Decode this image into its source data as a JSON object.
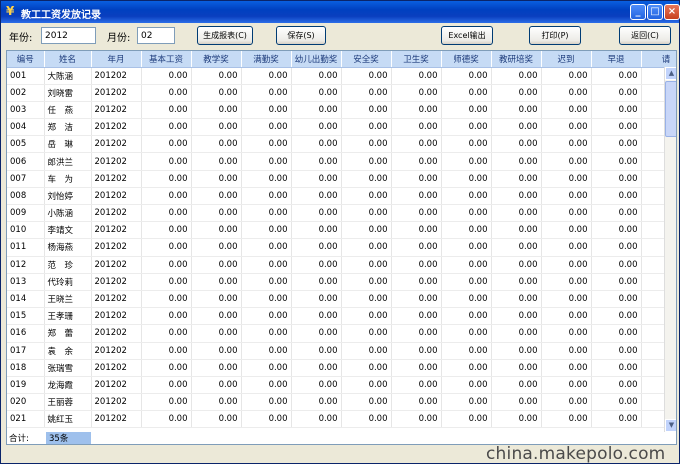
{
  "window": {
    "title": "教工工资发放记录"
  },
  "filters": {
    "year_label": "年份:",
    "year_value": "2012",
    "month_label": "月份:",
    "month_value": "02"
  },
  "toolbar": {
    "generate_label": "生成报表(C)",
    "save_label": "保存(S)",
    "excel_label": "Excel输出",
    "print_label": "打印(P)",
    "return_label": "返回(C)"
  },
  "table": {
    "headers": [
      "编号",
      "姓名",
      "年月",
      "基本工资",
      "教学奖",
      "满勤奖",
      "幼儿出勤奖",
      "安全奖",
      "卫生奖",
      "师德奖",
      "教研培奖",
      "迟到",
      "早退",
      "请"
    ],
    "rows": [
      {
        "id": "001",
        "name": "大陈涵",
        "ym": "201202",
        "v": [
          "0.00",
          "0.00",
          "0.00",
          "0.00",
          "0.00",
          "0.00",
          "0.00",
          "0.00",
          "0.00",
          "0.00"
        ]
      },
      {
        "id": "002",
        "name": "刘晓雷",
        "ym": "201202",
        "v": [
          "0.00",
          "0.00",
          "0.00",
          "0.00",
          "0.00",
          "0.00",
          "0.00",
          "0.00",
          "0.00",
          "0.00"
        ]
      },
      {
        "id": "003",
        "name": "任　燕",
        "ym": "201202",
        "v": [
          "0.00",
          "0.00",
          "0.00",
          "0.00",
          "0.00",
          "0.00",
          "0.00",
          "0.00",
          "0.00",
          "0.00"
        ]
      },
      {
        "id": "004",
        "name": "郑　洁",
        "ym": "201202",
        "v": [
          "0.00",
          "0.00",
          "0.00",
          "0.00",
          "0.00",
          "0.00",
          "0.00",
          "0.00",
          "0.00",
          "0.00"
        ]
      },
      {
        "id": "005",
        "name": "岳　琳",
        "ym": "201202",
        "v": [
          "0.00",
          "0.00",
          "0.00",
          "0.00",
          "0.00",
          "0.00",
          "0.00",
          "0.00",
          "0.00",
          "0.00"
        ]
      },
      {
        "id": "006",
        "name": "郎洪兰",
        "ym": "201202",
        "v": [
          "0.00",
          "0.00",
          "0.00",
          "0.00",
          "0.00",
          "0.00",
          "0.00",
          "0.00",
          "0.00",
          "0.00"
        ]
      },
      {
        "id": "007",
        "name": "车　为",
        "ym": "201202",
        "v": [
          "0.00",
          "0.00",
          "0.00",
          "0.00",
          "0.00",
          "0.00",
          "0.00",
          "0.00",
          "0.00",
          "0.00"
        ]
      },
      {
        "id": "008",
        "name": "刘怡婷",
        "ym": "201202",
        "v": [
          "0.00",
          "0.00",
          "0.00",
          "0.00",
          "0.00",
          "0.00",
          "0.00",
          "0.00",
          "0.00",
          "0.00"
        ]
      },
      {
        "id": "009",
        "name": "小陈涵",
        "ym": "201202",
        "v": [
          "0.00",
          "0.00",
          "0.00",
          "0.00",
          "0.00",
          "0.00",
          "0.00",
          "0.00",
          "0.00",
          "0.00"
        ]
      },
      {
        "id": "010",
        "name": "李靖文",
        "ym": "201202",
        "v": [
          "0.00",
          "0.00",
          "0.00",
          "0.00",
          "0.00",
          "0.00",
          "0.00",
          "0.00",
          "0.00",
          "0.00"
        ]
      },
      {
        "id": "011",
        "name": "杨海燕",
        "ym": "201202",
        "v": [
          "0.00",
          "0.00",
          "0.00",
          "0.00",
          "0.00",
          "0.00",
          "0.00",
          "0.00",
          "0.00",
          "0.00"
        ]
      },
      {
        "id": "012",
        "name": "范　珍",
        "ym": "201202",
        "v": [
          "0.00",
          "0.00",
          "0.00",
          "0.00",
          "0.00",
          "0.00",
          "0.00",
          "0.00",
          "0.00",
          "0.00"
        ]
      },
      {
        "id": "013",
        "name": "代玲莉",
        "ym": "201202",
        "v": [
          "0.00",
          "0.00",
          "0.00",
          "0.00",
          "0.00",
          "0.00",
          "0.00",
          "0.00",
          "0.00",
          "0.00"
        ]
      },
      {
        "id": "014",
        "name": "王晓兰",
        "ym": "201202",
        "v": [
          "0.00",
          "0.00",
          "0.00",
          "0.00",
          "0.00",
          "0.00",
          "0.00",
          "0.00",
          "0.00",
          "0.00"
        ]
      },
      {
        "id": "015",
        "name": "王孝珊",
        "ym": "201202",
        "v": [
          "0.00",
          "0.00",
          "0.00",
          "0.00",
          "0.00",
          "0.00",
          "0.00",
          "0.00",
          "0.00",
          "0.00"
        ]
      },
      {
        "id": "016",
        "name": "郑　蕾",
        "ym": "201202",
        "v": [
          "0.00",
          "0.00",
          "0.00",
          "0.00",
          "0.00",
          "0.00",
          "0.00",
          "0.00",
          "0.00",
          "0.00"
        ]
      },
      {
        "id": "017",
        "name": "袁　余",
        "ym": "201202",
        "v": [
          "0.00",
          "0.00",
          "0.00",
          "0.00",
          "0.00",
          "0.00",
          "0.00",
          "0.00",
          "0.00",
          "0.00"
        ]
      },
      {
        "id": "018",
        "name": "张瑞雪",
        "ym": "201202",
        "v": [
          "0.00",
          "0.00",
          "0.00",
          "0.00",
          "0.00",
          "0.00",
          "0.00",
          "0.00",
          "0.00",
          "0.00"
        ]
      },
      {
        "id": "019",
        "name": "龙海霞",
        "ym": "201202",
        "v": [
          "0.00",
          "0.00",
          "0.00",
          "0.00",
          "0.00",
          "0.00",
          "0.00",
          "0.00",
          "0.00",
          "0.00"
        ]
      },
      {
        "id": "020",
        "name": "王丽蓉",
        "ym": "201202",
        "v": [
          "0.00",
          "0.00",
          "0.00",
          "0.00",
          "0.00",
          "0.00",
          "0.00",
          "0.00",
          "0.00",
          "0.00"
        ]
      },
      {
        "id": "021",
        "name": "姚红玉",
        "ym": "201202",
        "v": [
          "0.00",
          "0.00",
          "0.00",
          "0.00",
          "0.00",
          "0.00",
          "0.00",
          "0.00",
          "0.00",
          "0.00"
        ]
      }
    ]
  },
  "footer": {
    "total_label": "合计:",
    "total_count": "35条"
  },
  "icons": {
    "app": "coin-icon",
    "minimize": "minimize-icon",
    "maximize": "maximize-icon",
    "close": "close-icon",
    "scroll_up": "scroll-up-icon",
    "scroll_down": "scroll-down-icon"
  },
  "watermark": "china.makepolo.com",
  "colors": {
    "title_bar": "#0040c0",
    "header_bg": "#c6dbf5",
    "footer_count_bg": "#9ec0ec"
  }
}
